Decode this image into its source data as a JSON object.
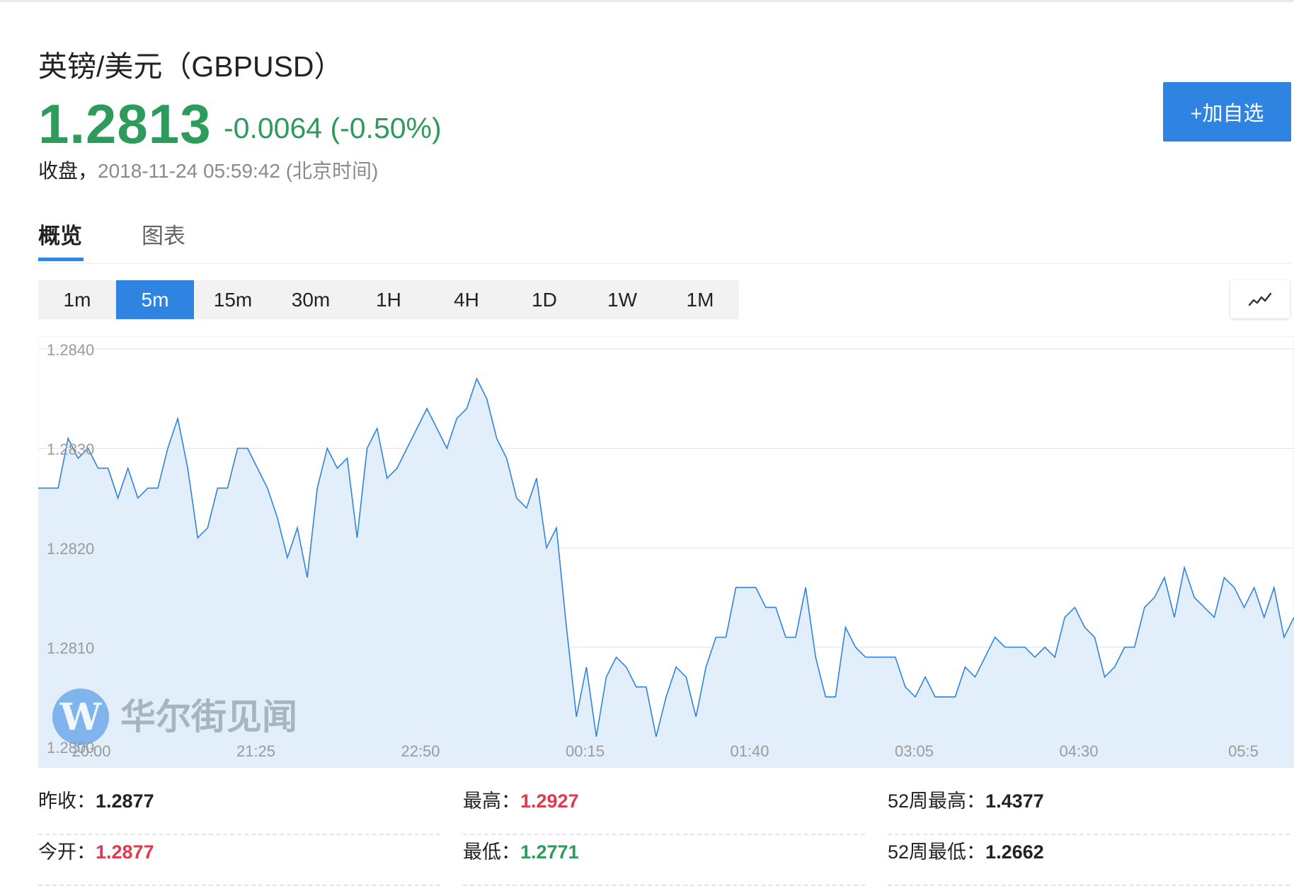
{
  "header": {
    "title": "英镑/美元（GBPUSD）",
    "price": "1.2813",
    "change": "-0.0064 (-0.50%)",
    "status_label": "收盘，",
    "timestamp": "2018-11-24 05:59:42 (北京时间)",
    "add_button": "+加自选",
    "accent_color": "#2e84e0",
    "down_color": "#2e9b5c",
    "up_color": "#e03a4e"
  },
  "tabs": [
    {
      "label": "概览",
      "active": true
    },
    {
      "label": "图表",
      "active": false
    }
  ],
  "periods": [
    {
      "label": "1m",
      "active": false
    },
    {
      "label": "5m",
      "active": true
    },
    {
      "label": "15m",
      "active": false
    },
    {
      "label": "30m",
      "active": false
    },
    {
      "label": "1H",
      "active": false
    },
    {
      "label": "4H",
      "active": false
    },
    {
      "label": "1D",
      "active": false
    },
    {
      "label": "1W",
      "active": false
    },
    {
      "label": "1M",
      "active": false
    }
  ],
  "chart_type_icon": "line-chart-icon",
  "watermark": {
    "text": "华尔街见闻",
    "logo": "W"
  },
  "chart_data": {
    "type": "area",
    "title": "",
    "xlabel": "",
    "ylabel": "",
    "ylim": [
      1.28,
      1.284
    ],
    "yticks": [
      "1.2840",
      "1.2830",
      "1.2820",
      "1.2810",
      "1.2800"
    ],
    "xticks": [
      "20:00",
      "21:25",
      "22:50",
      "00:15",
      "01:40",
      "03:05",
      "04:30",
      "05:5"
    ],
    "grid": true,
    "line_color": "#2e84e0",
    "fill_color": "#e2effb",
    "series": [
      {
        "values": [
          1.2826,
          1.2826,
          1.2826,
          1.2831,
          1.2829,
          1.283,
          1.2828,
          1.2828,
          1.2825,
          1.2828,
          1.2825,
          1.2826,
          1.2826,
          1.283,
          1.2833,
          1.2828,
          1.2821,
          1.2822,
          1.2826,
          1.2826,
          1.283,
          1.283,
          1.2828,
          1.2826,
          1.2823,
          1.2819,
          1.2822,
          1.2817,
          1.2826,
          1.283,
          1.2828,
          1.2829,
          1.2821,
          1.283,
          1.2832,
          1.2827,
          1.2828,
          1.283,
          1.2832,
          1.2834,
          1.2832,
          1.283,
          1.2833,
          1.2834,
          1.2837,
          1.2835,
          1.2831,
          1.2829,
          1.2825,
          1.2824,
          1.2827,
          1.282,
          1.2822,
          1.2812,
          1.2803,
          1.2808,
          1.2801,
          1.2807,
          1.2809,
          1.2808,
          1.2806,
          1.2806,
          1.2801,
          1.2805,
          1.2808,
          1.2807,
          1.2803,
          1.2808,
          1.2811,
          1.2811,
          1.2816,
          1.2816,
          1.2816,
          1.2814,
          1.2814,
          1.2811,
          1.2811,
          1.2816,
          1.2809,
          1.2805,
          1.2805,
          1.2812,
          1.281,
          1.2809,
          1.2809,
          1.2809,
          1.2809,
          1.2806,
          1.2805,
          1.2807,
          1.2805,
          1.2805,
          1.2805,
          1.2808,
          1.2807,
          1.2809,
          1.2811,
          1.281,
          1.281,
          1.281,
          1.2809,
          1.281,
          1.2809,
          1.2813,
          1.2814,
          1.2812,
          1.2811,
          1.2807,
          1.2808,
          1.281,
          1.281,
          1.2814,
          1.2815,
          1.2817,
          1.2813,
          1.2818,
          1.2815,
          1.2814,
          1.2813,
          1.2817,
          1.2816,
          1.2814,
          1.2816,
          1.2813,
          1.2816,
          1.2811,
          1.2813
        ]
      }
    ]
  },
  "stats": [
    {
      "label": "昨收：",
      "value": "1.2877",
      "tone": "dark"
    },
    {
      "label": "最高：",
      "value": "1.2927",
      "tone": "red"
    },
    {
      "label": "52周最高：",
      "value": "1.4377",
      "tone": "dark"
    },
    {
      "label": "今开：",
      "value": "1.2877",
      "tone": "red"
    },
    {
      "label": "最低：",
      "value": "1.2771",
      "tone": "green"
    },
    {
      "label": "52周最低：",
      "value": "1.2662",
      "tone": "dark"
    }
  ]
}
